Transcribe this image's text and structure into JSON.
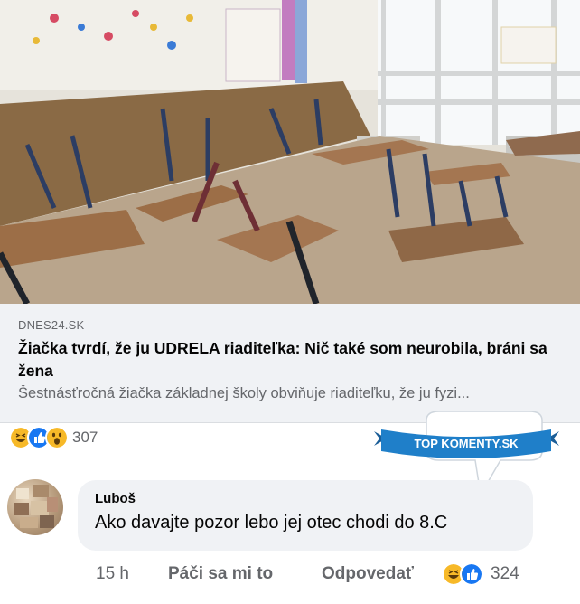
{
  "link_card": {
    "source": "DNES24.SK",
    "headline": "Žiačka tvrdí, že ju UDRELA riaditeľka: Nič také som neurobila, bráni sa žena",
    "snippet": "Šestnásťročná žiačka základnej školy obviňuje riaditeľku, že ju fyzi..."
  },
  "post_reactions": {
    "icons": [
      "haha-emoji-icon",
      "like-emoji-icon",
      "wow-emoji-icon"
    ],
    "count": "307"
  },
  "badge": {
    "label": "TOP KOMENTY.SK",
    "color": "#1f7fc9"
  },
  "comment": {
    "author": "Luboš",
    "text": "Ako davajte pozor lebo jej otec chodi do 8.C",
    "timestamp": "15 h",
    "like_label": "Páči sa mi to",
    "reply_label": "Odpovedať",
    "reactions": {
      "icons": [
        "haha-emoji-icon",
        "like-emoji-icon"
      ],
      "count": "324"
    }
  },
  "colors": {
    "like_blue": "#1877f2",
    "emoji_yellow": "#f7b928",
    "secondary_text": "#65676b"
  }
}
